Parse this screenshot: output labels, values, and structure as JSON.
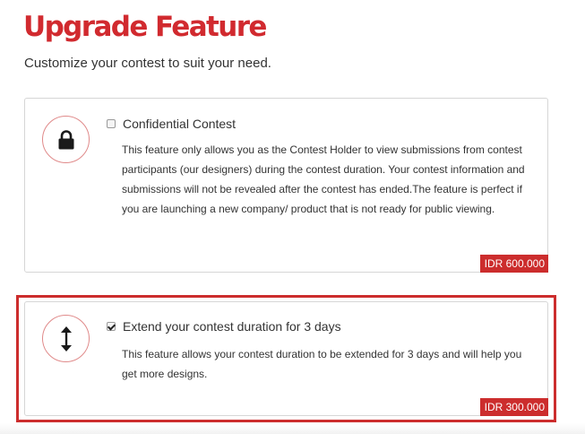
{
  "header": {
    "title": "Upgrade Feature",
    "subtitle": "Customize your contest to suit your need."
  },
  "features": [
    {
      "icon": "lock-icon",
      "checked": false,
      "label": "Confidential Contest",
      "description": "This feature only allows you as the Contest Holder to view submissions from contest participants (our designers) during the contest duration. Your contest information and submissions will not be revealed after the contest has ended.The feature is perfect if you are launching a new company/ product that is not ready for public viewing.",
      "price": "IDR 600.000"
    },
    {
      "icon": "vertical-arrows-icon",
      "checked": true,
      "label": "Extend your contest duration for 3 days",
      "description": "This feature allows your contest duration to be extended for 3 days and will help you get more designs.",
      "price": "IDR 300.000"
    }
  ],
  "colors": {
    "accent": "#d12a2f",
    "badge": "#cc2d2d",
    "highlight_border": "#cc2d2d",
    "icon_ring": "#e08a8a"
  }
}
